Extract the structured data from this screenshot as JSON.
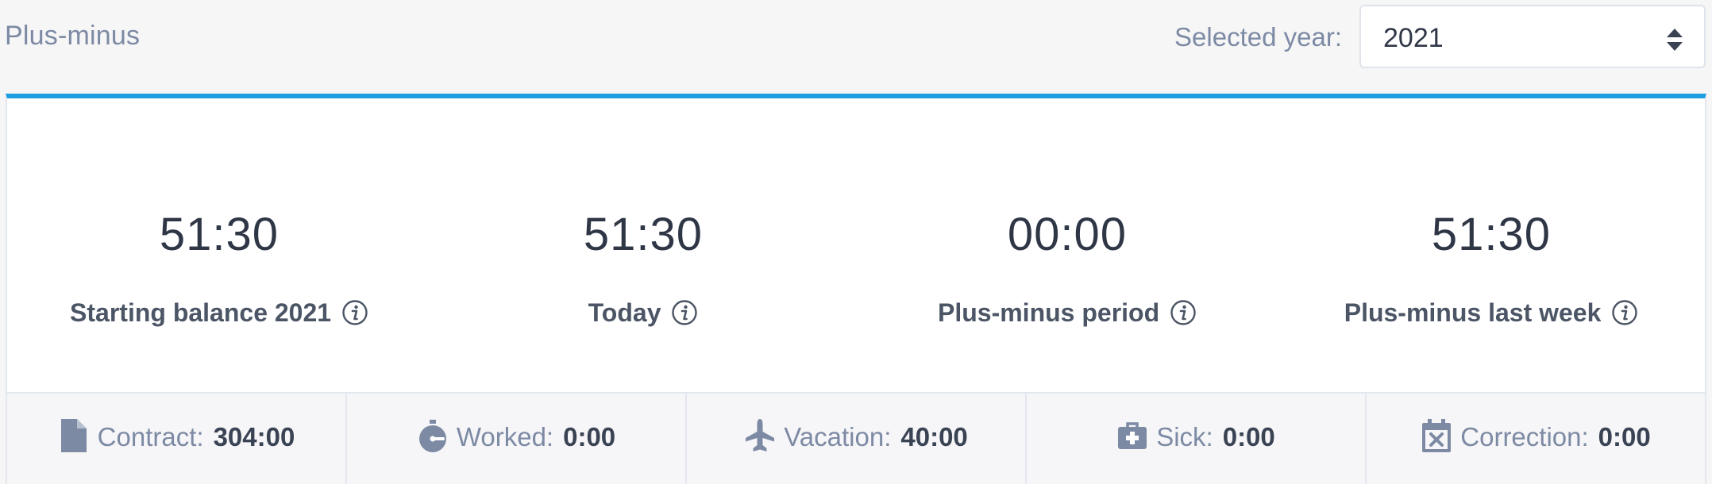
{
  "header": {
    "title": "Plus-minus",
    "year_label": "Selected year:",
    "year_value": "2021"
  },
  "accent_color": "#1f9de1",
  "stats": [
    {
      "value": "51:30",
      "label": "Starting balance 2021",
      "icon": "info-icon"
    },
    {
      "value": "51:30",
      "label": "Today",
      "icon": "info-icon"
    },
    {
      "value": "00:00",
      "label": "Plus-minus period",
      "icon": "info-icon"
    },
    {
      "value": "51:30",
      "label": "Plus-minus last week",
      "icon": "info-icon"
    }
  ],
  "breakdown": [
    {
      "label": "Contract:",
      "value": "304:00",
      "icon": "document-icon"
    },
    {
      "label": "Worked:",
      "value": "0:00",
      "icon": "stopwatch-icon"
    },
    {
      "label": "Vacation:",
      "value": "40:00",
      "icon": "airplane-icon"
    },
    {
      "label": "Sick:",
      "value": "0:00",
      "icon": "medical-kit-icon"
    },
    {
      "label": "Correction:",
      "value": "0:00",
      "icon": "calendar-x-icon"
    }
  ]
}
